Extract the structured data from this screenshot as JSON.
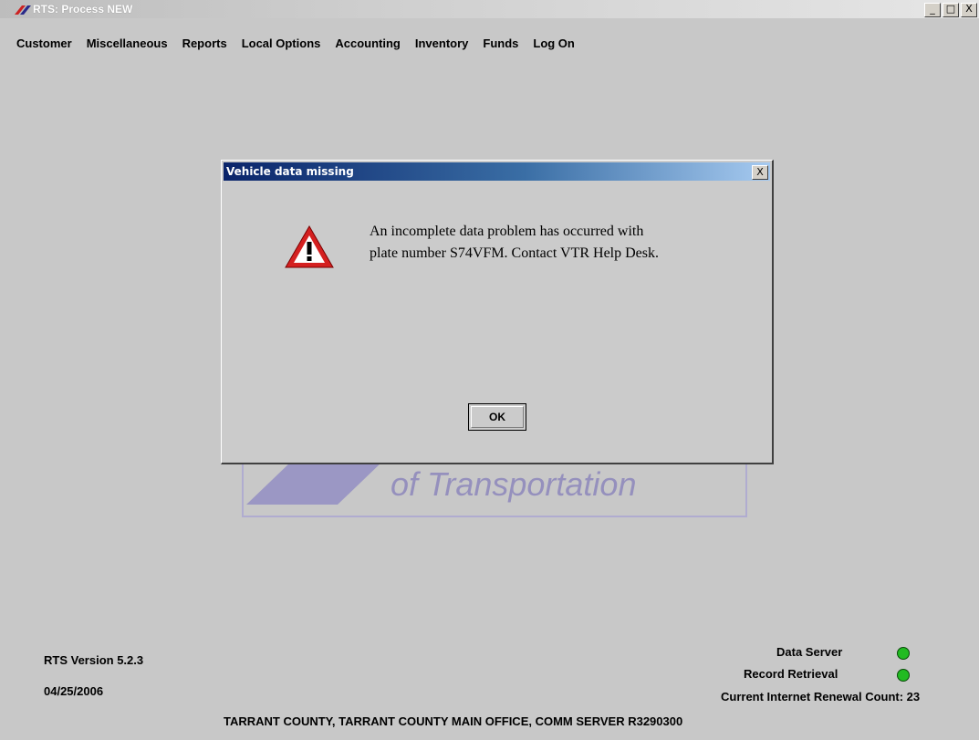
{
  "window": {
    "title": "RTS: Process NEW",
    "minimize_label": "_",
    "maximize_label": "□",
    "close_label": "X"
  },
  "menu": {
    "items": [
      {
        "label": "Customer",
        "mnemonic_index": null
      },
      {
        "label": "Miscellaneous"
      },
      {
        "label": "Reports"
      },
      {
        "label": "Local Options"
      },
      {
        "label": "Accounting"
      },
      {
        "label": "Inventory"
      },
      {
        "label": "Funds"
      },
      {
        "label": "Log On"
      }
    ]
  },
  "background_logo": {
    "text": "of Transportation"
  },
  "dialog": {
    "title": "Vehicle data missing",
    "close_label": "X",
    "icon": "warning-icon",
    "message_line1": "An incomplete data problem has occurred with",
    "message_line2": "plate number S74VFM. Contact VTR Help Desk.",
    "ok_label": "OK"
  },
  "status": {
    "version": "RTS Version 5.2.3",
    "date": "04/25/2006",
    "data_server_label": "Data Server",
    "record_retrieval_label": "Record Retrieval",
    "renewal_count_label": "Current Internet Renewal Count: 23",
    "led_color": "#22bb22"
  },
  "footer": {
    "text": "TARRANT COUNTY, TARRANT COUNTY MAIN OFFICE, COMM SERVER R3290300"
  }
}
